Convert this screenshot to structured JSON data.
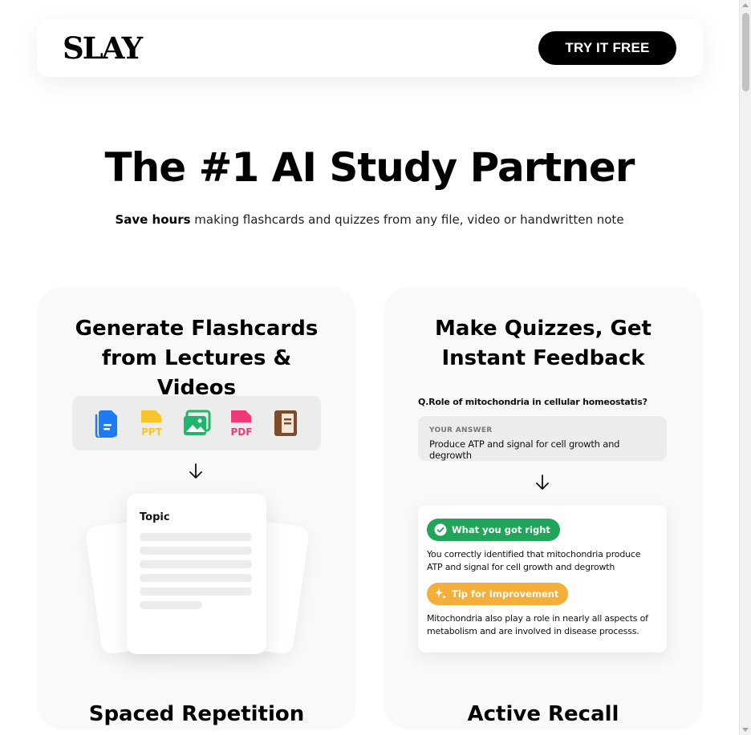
{
  "nav": {
    "logo": "SLAY",
    "cta_label": "TRY IT FREE"
  },
  "hero": {
    "title": "The #1 AI Study Partner",
    "subtitle_bold": "Save hours",
    "subtitle_rest": " making flashcards and quizzes from any file, video or handwritten note"
  },
  "card_flashcards": {
    "title": "Generate Flashcards from Lectures & Videos",
    "file_types": [
      {
        "icon": "doc-icon",
        "label": "",
        "color": "#1e7bf2"
      },
      {
        "icon": "ppt-icon",
        "label": "PPT",
        "color": "#f7c52b"
      },
      {
        "icon": "image-icon",
        "label": "",
        "color": "#1fb86a"
      },
      {
        "icon": "pdf-icon",
        "label": "PDF",
        "color": "#f0387a"
      },
      {
        "icon": "notebook-icon",
        "label": "",
        "color": "#7d4a2a"
      }
    ],
    "doc_title": "Topic",
    "footer": "Spaced Repetition"
  },
  "card_quiz": {
    "title": "Make Quizzes, Get Instant Feedback",
    "question": "Q.Role of mitochondria in cellular homeostatis?",
    "answer_label": "YOUR ANSWER",
    "answer_value": "Produce ATP and signal for cell growth and degrowth",
    "right_label": "What you got right",
    "right_text": "You correctly identified that mitochondria produce ATP and signal for cell growth and degrowth",
    "tip_label": "Tip for Improvement",
    "tip_text": "Mitochondria also play a role in nearly all aspects of metabolism and are involved in disease processs.",
    "footer": "Active Recall"
  },
  "colors": {
    "accent_green": "#21a55a",
    "accent_orange": "#f4ae3a",
    "cta_bg": "#000000"
  }
}
